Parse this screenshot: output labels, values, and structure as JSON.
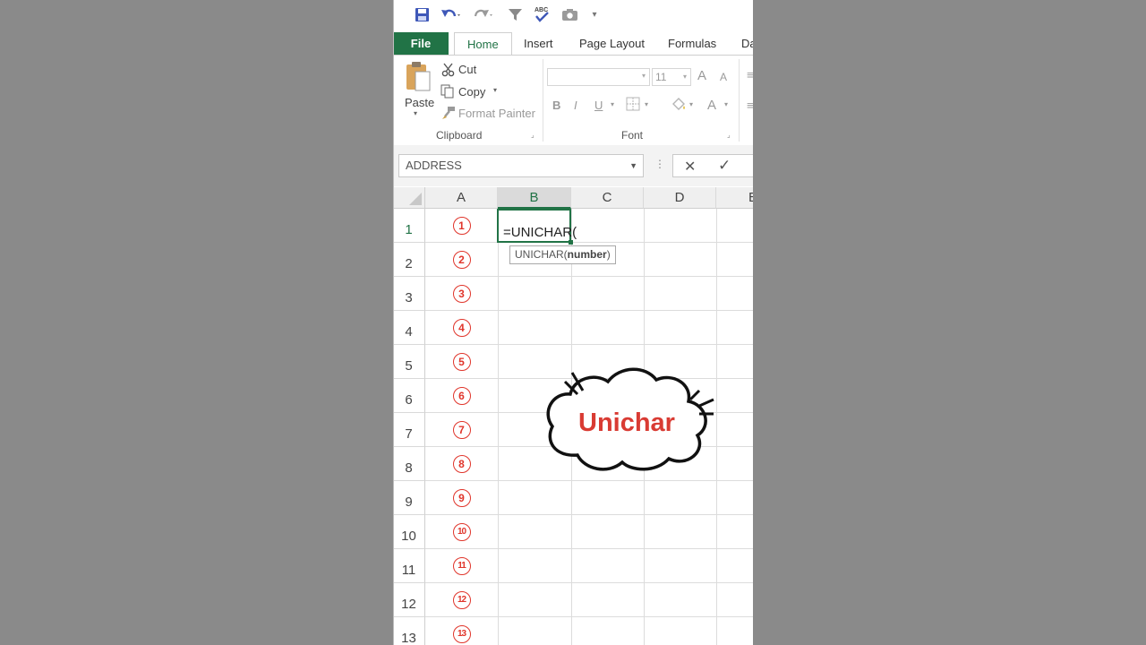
{
  "ribbon": {
    "tabs": [
      "File",
      "Home",
      "Insert",
      "Page Layout",
      "Formulas",
      "Da"
    ],
    "active_tab": "Home",
    "clipboard": {
      "paste": "Paste",
      "cut": "Cut",
      "copy": "Copy",
      "format_painter": "Format Painter",
      "group_label": "Clipboard"
    },
    "font": {
      "font_size": "11",
      "bold": "B",
      "italic": "I",
      "underline": "U",
      "grow": "A",
      "shrink": "A",
      "color": "A",
      "group_label": "Font"
    }
  },
  "formula_bar": {
    "name_box": "ADDRESS",
    "cancel": "✕",
    "enter": "✓"
  },
  "sheet": {
    "columns": [
      "A",
      "B",
      "C",
      "D",
      "E"
    ],
    "selected_column": "B",
    "rows": [
      "1",
      "2",
      "3",
      "4",
      "5",
      "6",
      "7",
      "8",
      "9",
      "10",
      "11",
      "12",
      "13"
    ],
    "column_a_values": [
      "1",
      "2",
      "3",
      "4",
      "5",
      "6",
      "7",
      "8",
      "9",
      "10",
      "11",
      "12",
      "13"
    ],
    "active_cell_text": "=UNICHAR(",
    "tooltip_fn": "UNICHAR(",
    "tooltip_arg": "number",
    "tooltip_close": ")"
  },
  "overlay": {
    "label": "Unichar",
    "color": "#d93b33"
  },
  "colors": {
    "accent": "#217346",
    "circle_red": "#e0352b"
  }
}
